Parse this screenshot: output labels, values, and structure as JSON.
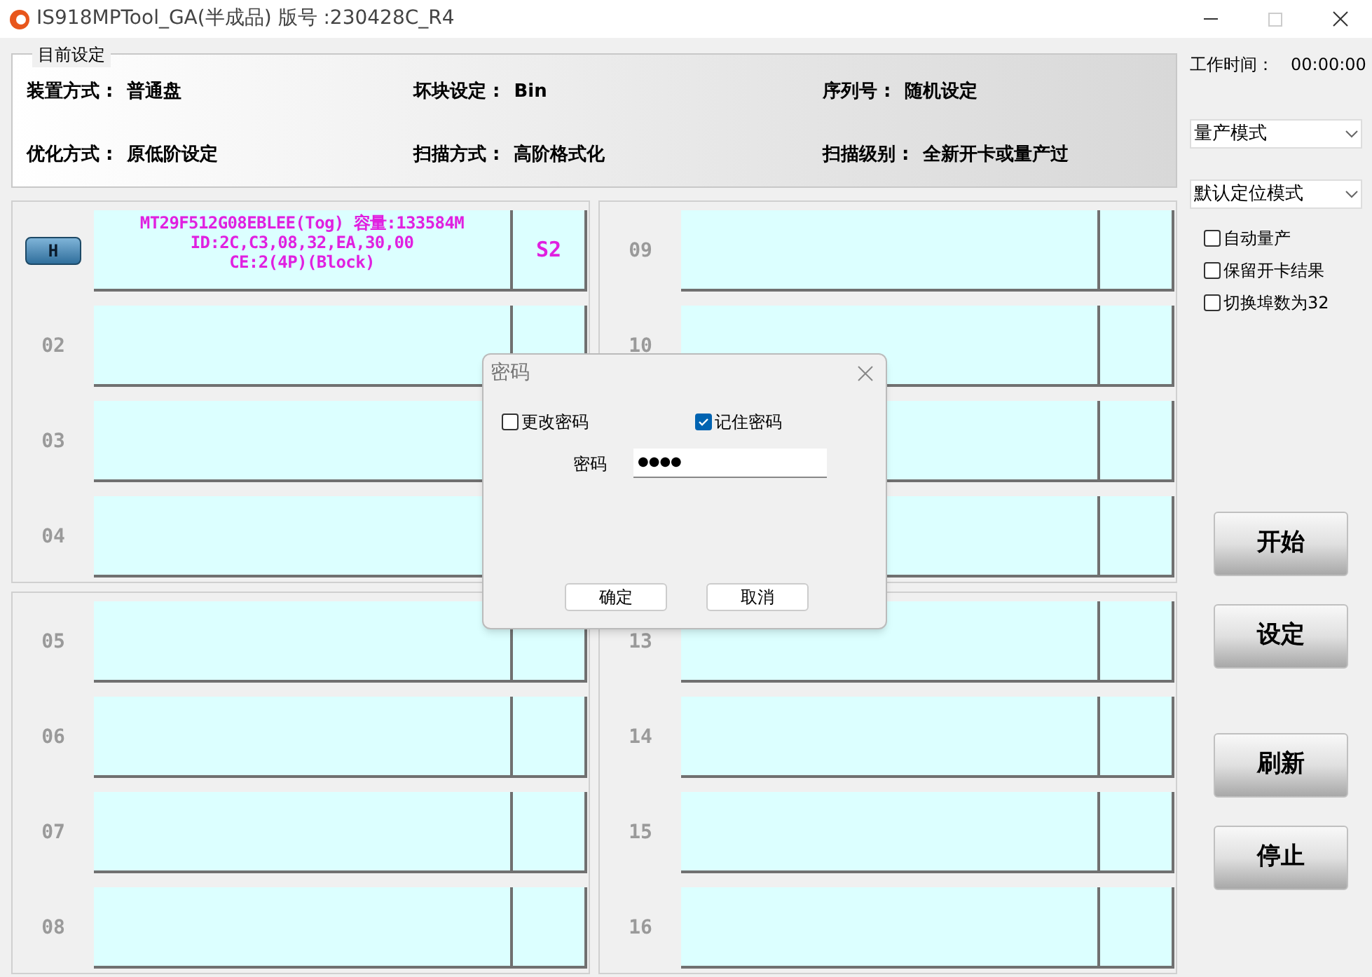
{
  "window": {
    "title": "IS918MPTool_GA(半成品) 版号 :230428C_R4"
  },
  "settings": {
    "title": "目前设定",
    "fields": [
      {
        "label": "装置方式 :",
        "value": "普通盘"
      },
      {
        "label": "坏块设定 :",
        "value": "Bin"
      },
      {
        "label": "序列号 :",
        "value": "随机设定"
      },
      {
        "label": "优化方式 :",
        "value": "原低阶设定"
      },
      {
        "label": "扫描方式 :",
        "value": "高阶格式化"
      },
      {
        "label": "扫描级别 :",
        "value": "全新开卡或量产过"
      }
    ]
  },
  "slot_groups": [
    {
      "slots": [
        {
          "kind": "device",
          "badge": "H",
          "info": [
            "MT29F512G08EBLEE(Tog) 容量:133584M",
            "ID:2C,C3,08,32,EA,30,00",
            "CE:2(4P)(Block)"
          ],
          "status": "S2"
        },
        {
          "kind": "empty",
          "label": "02"
        },
        {
          "kind": "empty",
          "label": "03"
        },
        {
          "kind": "empty",
          "label": "04"
        }
      ]
    },
    {
      "slots": [
        {
          "kind": "empty",
          "label": "09"
        },
        {
          "kind": "empty",
          "label": "10"
        },
        {
          "kind": "empty"
        },
        {
          "kind": "empty"
        }
      ]
    },
    {
      "slots": [
        {
          "kind": "empty",
          "label": "05"
        },
        {
          "kind": "empty",
          "label": "06"
        },
        {
          "kind": "empty",
          "label": "07"
        },
        {
          "kind": "empty",
          "label": "08"
        }
      ]
    },
    {
      "slots": [
        {
          "kind": "empty",
          "label": "13"
        },
        {
          "kind": "empty",
          "label": "14"
        },
        {
          "kind": "empty",
          "label": "15"
        },
        {
          "kind": "empty",
          "label": "16"
        }
      ]
    }
  ],
  "side_panel": {
    "work_time": {
      "label": "工作时间：",
      "value": "00:00:00"
    },
    "selects": [
      {
        "value": "量产模式"
      },
      {
        "value": "默认定位模式"
      }
    ],
    "checkboxes": [
      {
        "label": "自动量产",
        "checked": false
      },
      {
        "label": "保留开卡结果",
        "checked": false
      },
      {
        "label": "切换埠数为32",
        "checked": false
      }
    ],
    "buttons": [
      "开始",
      "设定",
      "刷新",
      "停止"
    ]
  },
  "dialog": {
    "title": "密码",
    "checkboxes": [
      {
        "label": "更改密码",
        "checked": false
      },
      {
        "label": "记住密码",
        "checked": true
      }
    ],
    "password": {
      "label": "密码",
      "value": "●●●●"
    },
    "buttons": [
      "确定",
      "取消"
    ]
  }
}
